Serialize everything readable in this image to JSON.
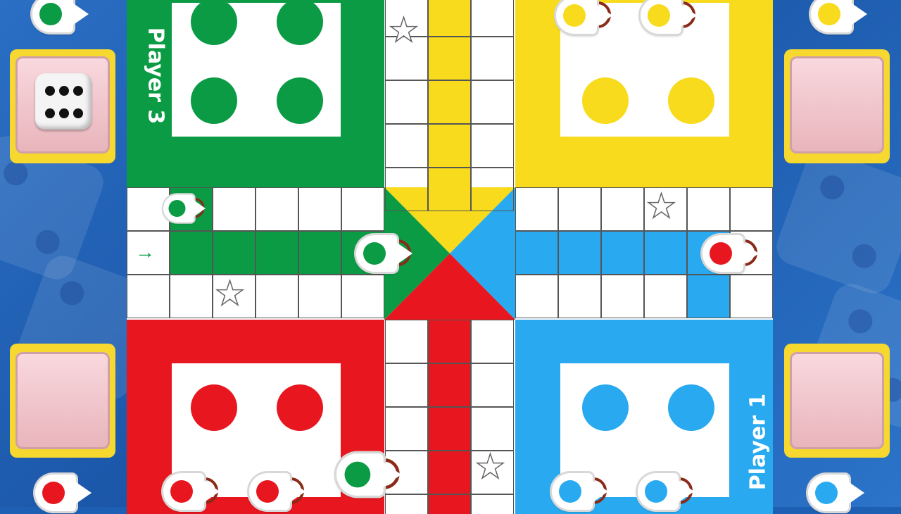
{
  "players": {
    "top_left_label": "Player 3",
    "bottom_right_label": "Player 1"
  },
  "dice": {
    "value": 6,
    "owner": "Player 3"
  },
  "colors": {
    "green": "#0b9b45",
    "yellow": "#f7db1c",
    "blue": "#29aaf0",
    "red": "#e8171f"
  },
  "icons": {
    "star": "★",
    "arrow": "→"
  }
}
